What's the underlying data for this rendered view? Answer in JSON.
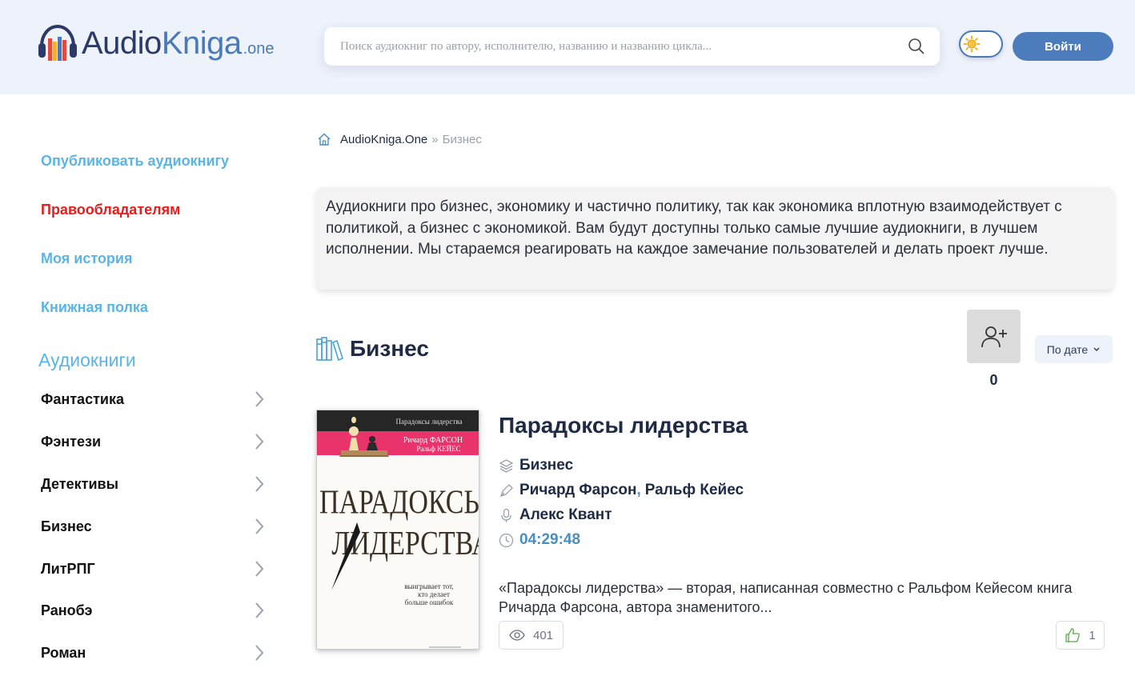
{
  "header": {
    "logo": {
      "part1": "Audio",
      "part2": "Kniga",
      "part3": ".one"
    },
    "search": {
      "placeholder": "Поиск аудиокниг по автору, исполнителю, названию и названию цикла..."
    },
    "login_label": "Войти"
  },
  "sidebar": {
    "links": [
      {
        "label": "Опубликовать аудиокнигу",
        "color": "#5ab5e6"
      },
      {
        "label": "Правообладателям",
        "color": "#e51d1d"
      },
      {
        "label": "Моя история",
        "color": "#5ab5e6"
      },
      {
        "label": "Книжная полка",
        "color": "#5ab5e6"
      }
    ],
    "heading": "Аудиокниги",
    "genres": [
      "Фантастика",
      "Фэнтези",
      "Детективы",
      "Бизнес",
      "ЛитРПГ",
      "Ранобэ",
      "Роман"
    ]
  },
  "breadcrumb": {
    "home": "AudioKniga.One",
    "separator": "»",
    "current": "Бизнес"
  },
  "description": "Аудиокниги про бизнес, экономику и частично политику, так как экономика вплотную взаимодействует с политикой, а бизнес с экономикой. Вам будут доступны только самые лучшие аудиокниги, в лучшем исполнении. Мы стараемся реагировать на каждое замечание пользователей и делать проект лучше.",
  "category": {
    "name": "Бизнес",
    "subscribers": "0",
    "sort_label": "По дате"
  },
  "book": {
    "title": "Парадоксы лидерства",
    "genre": "Бизнес",
    "author1": "Ричард Фарсон",
    "author_sep": ",",
    "author2": "Ральф Кейес",
    "narrator": "Алекс Квант",
    "duration": "04:29:48",
    "excerpt": "«Парадоксы лидерства» — вторая, написанная совместно с Ральфом Кейесом книга Ричарда Фарсона, автора знаменитого...",
    "views": "401",
    "likes": "1",
    "cover": {
      "series": "Парадоксы лидерства",
      "authors_line1": "Ричард ФАРСОН",
      "authors_line2": "Ральф КЕЙЕС",
      "title1": "ПАРАДОКСЫ",
      "title2": "ЛИДЕРСТВА",
      "tagline1": "выигрывает тот,",
      "tagline2": "кто делает",
      "tagline3": "больше ошибок"
    }
  },
  "colors": {
    "accent": "#4d7cbd",
    "sidebar_link": "#5ab5e6",
    "alert": "#e51d1d",
    "header_bg": "#eef2fb"
  }
}
